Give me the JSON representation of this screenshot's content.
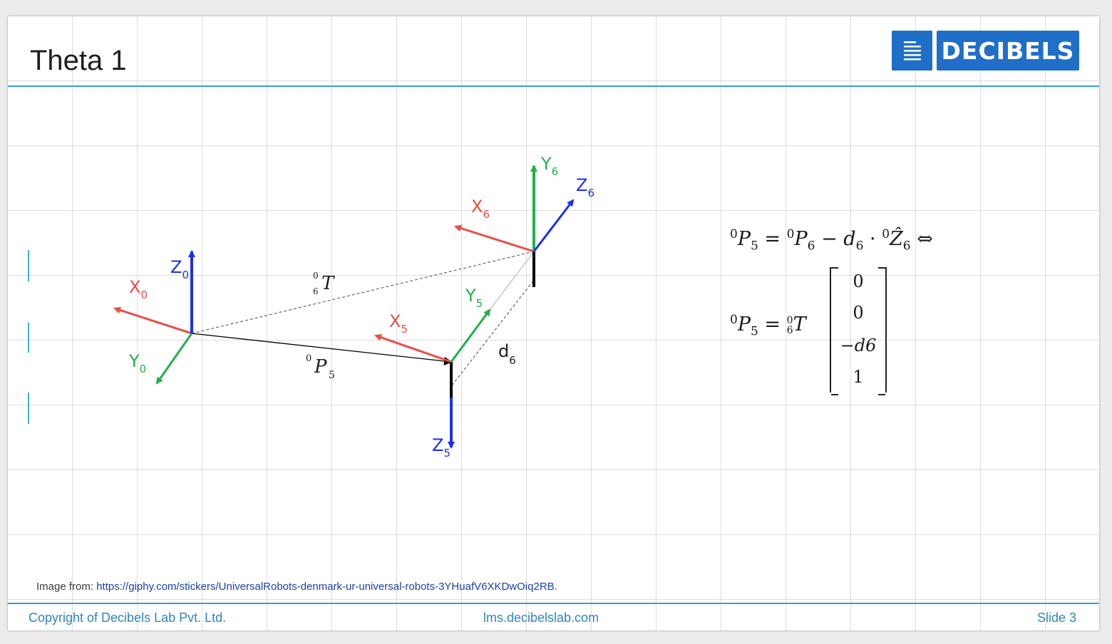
{
  "slide": {
    "title": "Theta 1",
    "logo_text": "DECIBELS",
    "logo_icon": "document-lines-icon"
  },
  "diagram": {
    "frame0": {
      "x": "X",
      "x_sub": "0",
      "y": "Y",
      "y_sub": "0",
      "z": "Z",
      "z_sub": "0"
    },
    "frame5": {
      "x": "X",
      "x_sub": "5",
      "y": "Y",
      "y_sub": "5",
      "z": "Z",
      "z_sub": "5"
    },
    "frame6": {
      "x": "X",
      "x_sub": "6",
      "y": "Y",
      "y_sub": "6",
      "z": "Z",
      "z_sub": "6"
    },
    "t_label": "T",
    "t_sup": "0",
    "t_sub": "6",
    "p_label": "P",
    "p_sup": "0",
    "p_sub": "5",
    "d_label": "d",
    "d_sub": "6",
    "colors": {
      "x_axis": "#ef4a43",
      "y_axis": "#20b04b",
      "z_axis": "#1c2ff0",
      "link": "#000000"
    }
  },
  "equations": {
    "line1": {
      "lhs_sup": "0",
      "lhs": "P",
      "lhs_sub": "5",
      "eq": "=",
      "t1_sup": "0",
      "t1": "P",
      "t1_sub": "6",
      "minus": "−",
      "t2": "d",
      "t2_sub": "6",
      "dot": "·",
      "t3_sup": "0",
      "t3": "Ẑ",
      "t3_sub": "6",
      "iff": "⇔"
    },
    "line2": {
      "lhs_sup": "0",
      "lhs": "P",
      "lhs_sub": "5",
      "eq": "=",
      "t_sup": "0",
      "t_sub": "6",
      "t": "T"
    },
    "matrix": [
      "0",
      "0",
      "−d6",
      "1"
    ]
  },
  "credit": {
    "prefix": "Image from: ",
    "url": "https://giphy.com/stickers/UniversalRobots-denmark-ur-universal-robots-3YHuafV6XKDwOiq2RB",
    "suffix": "."
  },
  "footer": {
    "left": "Copyright of Decibels Lab Pvt. Ltd.",
    "center": "lms.decibelslab.com",
    "right": "Slide 3"
  }
}
